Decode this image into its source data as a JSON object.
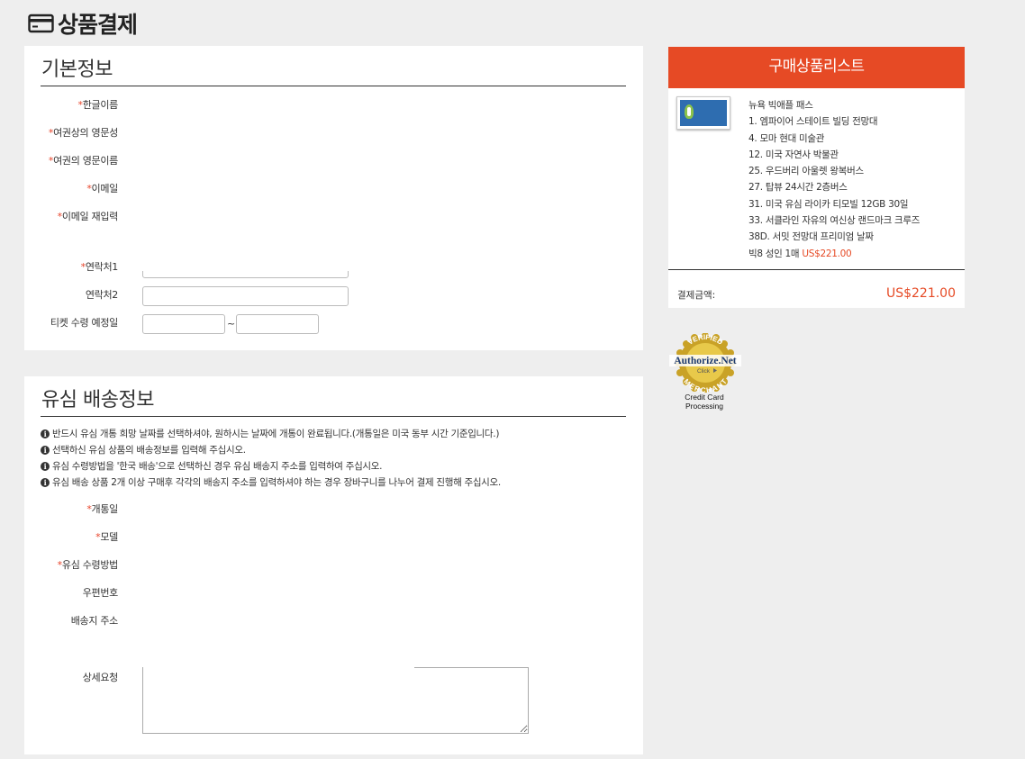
{
  "page": {
    "title": "상품결제",
    "title_icon": "credit-card-icon"
  },
  "basic_info": {
    "title": "기본정보",
    "required_mark": "*",
    "fields": {
      "korean_name": "한글이름",
      "passport_last_name": "여권상의 영문성",
      "passport_first_name": "여권의 영문이름",
      "email": "이메일",
      "email_confirm": "이메일 재입력",
      "phone1": "연락처1",
      "phone2": "연락처2",
      "ticket_receive_date": "티켓 수령 예정일"
    },
    "phone2_value": "",
    "date_from": "",
    "date_to": "",
    "date_separator": "~"
  },
  "usim_info": {
    "title": "유심 배송정보",
    "notice_icon": "info-circle-icon",
    "notices": [
      "반드시 유심 개통 희망 날짜를 선택하셔야, 원하시는 날짜에 개통이 완료됩니다.(개통일은 미국 동부 시간 기준입니다.)",
      "선택하신 유심 상품의 배송정보를 입력해 주십시오.",
      "유심 수령방법을 '한국 배송'으로 선택하신 경우 유심 배송지 주소를 입력하여 주십시오.",
      "유심 배송 상품 2개 이상 구매후 각각의 배송지 주소를 입력하셔야 하는 경우 장바구니를 나누어 결제 진행해 주십시오."
    ],
    "fields": {
      "activation_date": "개통일",
      "model": "모델",
      "receive_method": "유심 수령방법",
      "postal_code": "우편번호",
      "address": "배송지 주소",
      "request": "상세요청"
    },
    "request_value": ""
  },
  "cart": {
    "title": "구매상품리스트",
    "accent": "#e64a25",
    "product_lines": [
      "뉴욕 빅애플 패스",
      "1. 엠파이어 스테이트 빌딩 전망대",
      "4. 모마 현대 미술관",
      "12. 미국 자연사 박물관",
      "25. 우드버리 아울렛 왕복버스",
      "27. 탑뷰 24시간 2층버스",
      "31. 미국 유심 라이카 티모빌 12GB 30일",
      "33. 서클라인 자유의 여신상 랜드마크 크루즈",
      "38D. 서밋 전망대 프리미엄 날짜"
    ],
    "qty_text": "빅8 성인 1매 ",
    "qty_price": "US$221.00",
    "total_label": "결제금액:",
    "total_value": "US$221.00"
  },
  "badge": {
    "arc_top": "VERIFIED",
    "name": "Authorize.Net",
    "click": "Click",
    "arc_bottom": "MERCHANT",
    "caption_line1": "Credit Card",
    "caption_line2": "Processing"
  }
}
